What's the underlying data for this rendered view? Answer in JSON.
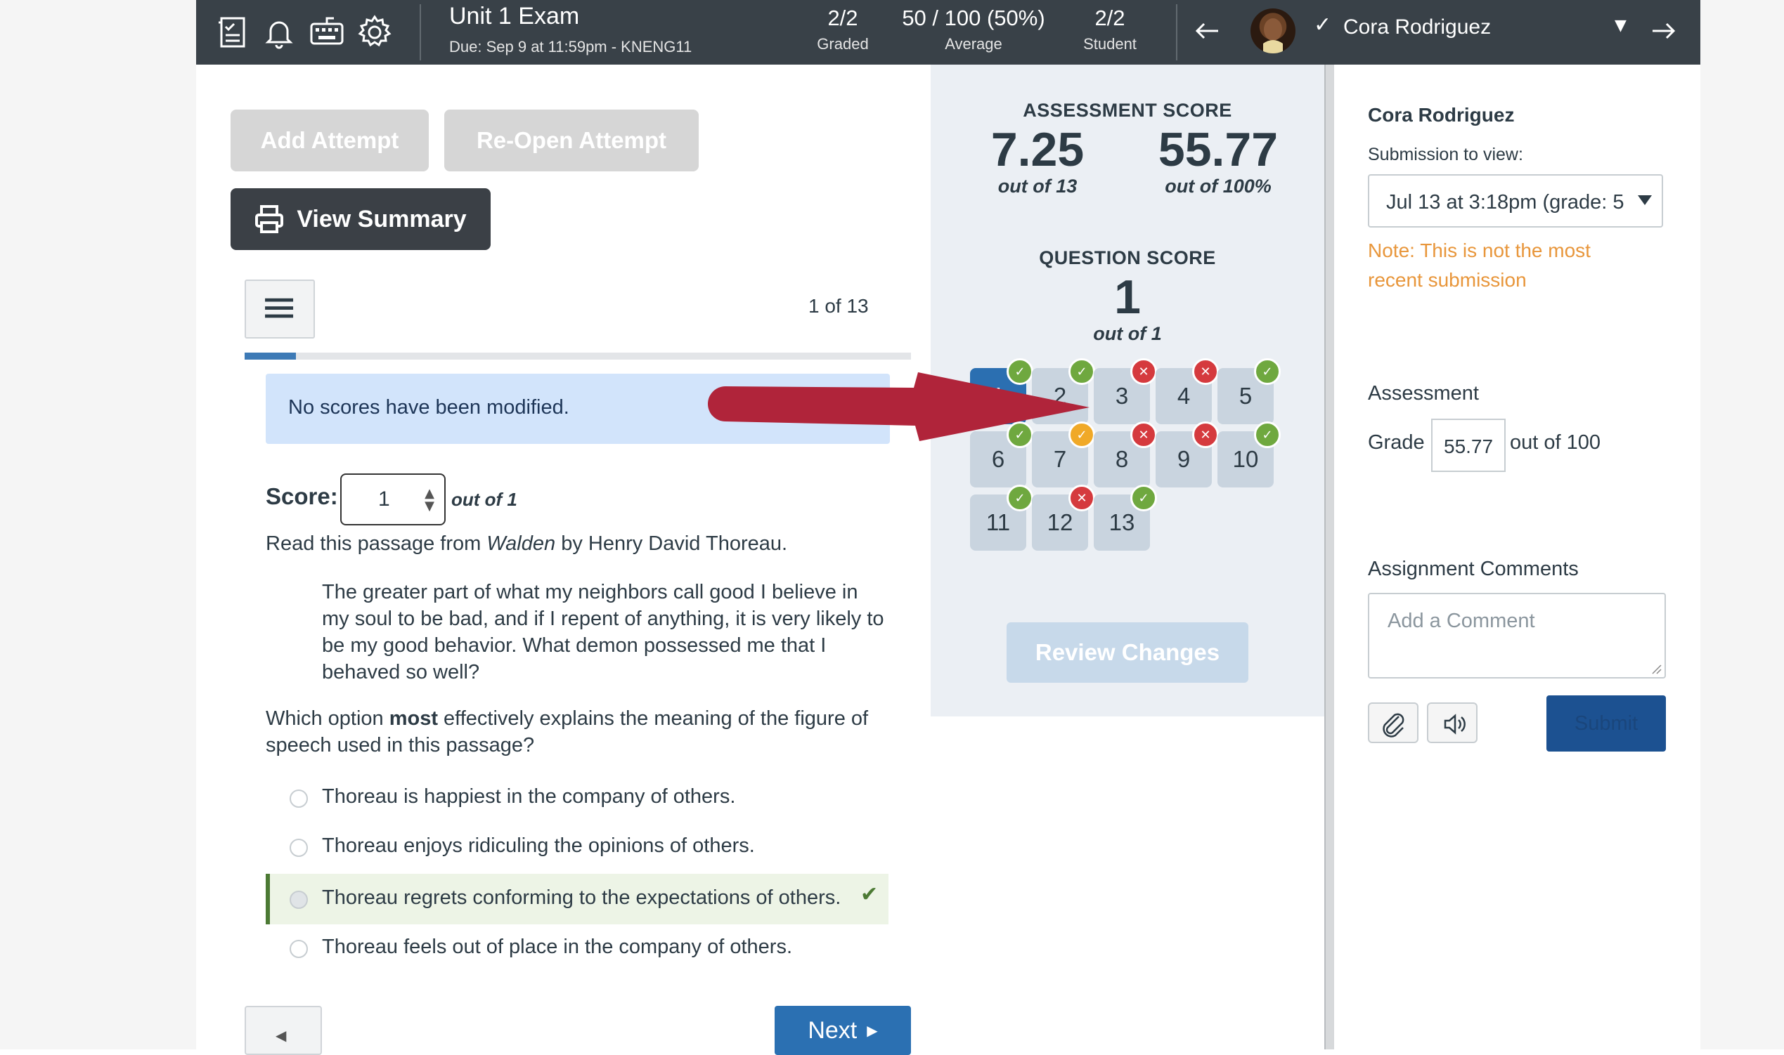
{
  "header": {
    "exam_title": "Unit 1 Exam",
    "due": "Due: Sep 9 at 11:59pm - KNENG11",
    "graded_value": "2/2",
    "graded_label": "Graded",
    "average_value": "50 / 100 (50%)",
    "average_label": "Average",
    "student_value": "2/2",
    "student_label": "Student",
    "student_name": "Cora Rodriguez",
    "icons": [
      "gradebook-icon",
      "bell-icon",
      "keyboard-icon",
      "gear-icon"
    ]
  },
  "actions": {
    "add_attempt": "Add Attempt",
    "reopen_attempt": "Re-Open Attempt",
    "view_summary": "View Summary"
  },
  "question_nav": {
    "counter": "1 of 13",
    "progress_fraction": 0.077
  },
  "alert": "No scores have been modified.",
  "score": {
    "label": "Score:",
    "value": "1",
    "out_of": "out of 1"
  },
  "question": {
    "intro_prefix": "Read this passage from ",
    "intro_title": "Walden",
    "intro_suffix": " by Henry David Thoreau.",
    "passage": "The greater part of what my neighbors call good I believe in my soul to be bad, and if I repent of anything, it is very likely to be my good behavior. What demon possessed me that I behaved so well?",
    "prompt_prefix": "Which option ",
    "prompt_bold": "most",
    "prompt_suffix": " effectively explains the meaning of the figure of speech used in this passage?",
    "options": [
      "Thoreau is happiest in the company of others.",
      "Thoreau enjoys ridiculing the opinions of others.",
      "Thoreau regrets conforming to the expectations of others.",
      "Thoreau feels out of place in the company of others."
    ],
    "correct_index": 2
  },
  "pager": {
    "next": "Next"
  },
  "assessment_score": {
    "title": "ASSESSMENT SCORE",
    "points": "7.25",
    "points_sub": "out of 13",
    "percent": "55.77",
    "percent_sub": "out of 100%"
  },
  "question_score": {
    "title": "QUESTION SCORE",
    "value": "1",
    "sub": "out of 1"
  },
  "question_tiles": [
    {
      "num": "1",
      "status": "correct",
      "current": true
    },
    {
      "num": "2",
      "status": "correct"
    },
    {
      "num": "3",
      "status": "incorrect"
    },
    {
      "num": "4",
      "status": "incorrect"
    },
    {
      "num": "5",
      "status": "correct"
    },
    {
      "num": "6",
      "status": "correct"
    },
    {
      "num": "7",
      "status": "partial"
    },
    {
      "num": "8",
      "status": "incorrect"
    },
    {
      "num": "9",
      "status": "incorrect"
    },
    {
      "num": "10",
      "status": "correct"
    },
    {
      "num": "11",
      "status": "correct"
    },
    {
      "num": "12",
      "status": "incorrect"
    },
    {
      "num": "13",
      "status": "correct"
    }
  ],
  "review_changes": "Review Changes",
  "right_panel": {
    "student_name": "Cora Rodriguez",
    "submission_label": "Submission to view:",
    "submission_value": "Jul 13 at 3:18pm (grade: 5",
    "note": "Note: This is not the most recent submission",
    "assessment_heading": "Assessment",
    "grade_label": "Grade",
    "grade_value": "55.77",
    "grade_out_of": "out of 100",
    "comments_heading": "Assignment Comments",
    "comment_placeholder": "Add a Comment",
    "submit": "Submit"
  },
  "colors": {
    "header_bg": "#394148",
    "accent_blue": "#2b6fb1",
    "correct_green": "#6fa83f",
    "incorrect_red": "#d53a3e",
    "partial_orange": "#f0a928",
    "note_orange": "#e8963b",
    "annotation_arrow": "#b0243a"
  }
}
